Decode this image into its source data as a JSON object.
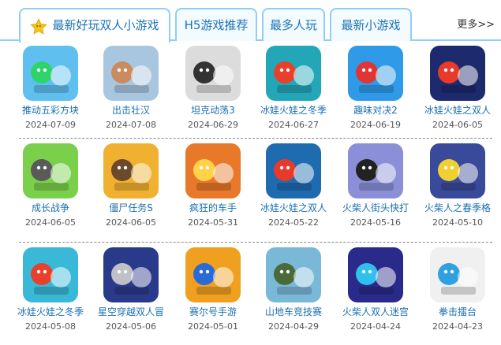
{
  "tabs": [
    {
      "label": "最新好玩双人小游戏",
      "active": true,
      "icon": "star-icon"
    },
    {
      "label": "H5游戏推荐",
      "active": false
    },
    {
      "label": "最多人玩",
      "active": false
    },
    {
      "label": "最新小游戏",
      "active": false
    }
  ],
  "more_label": "更多>>",
  "colors": {
    "accent": "#1a73b5",
    "tab_border": "#8fcff5"
  },
  "games": [
    [
      {
        "name": "推动五彩方块",
        "date": "2024-07-09",
        "bg": "#5fc0f0",
        "fg": "#2ed36a",
        "icon": "colorful-blocks-thumbnail"
      },
      {
        "name": "出击壮汉",
        "date": "2024-07-08",
        "bg": "#a8c6e0",
        "fg": "#c98b5f",
        "icon": "strongman-thumbnail"
      },
      {
        "name": "坦克动荡3",
        "date": "2024-06-29",
        "bg": "#dcdcdc",
        "fg": "#333333",
        "icon": "tank-thumbnail"
      },
      {
        "name": "冰娃火娃之冬季",
        "date": "2024-06-27",
        "bg": "#23a7b8",
        "fg": "#e8402b",
        "icon": "fire-water-winter-thumbnail"
      },
      {
        "name": "趣味对决2",
        "date": "2024-06-19",
        "bg": "#2e9ae8",
        "fg": "#e03535",
        "icon": "fun-duel-thumbnail"
      },
      {
        "name": "冰娃火娃之双人",
        "date": "2024-06-05",
        "bg": "#1e2a6e",
        "fg": "#e83a2a",
        "icon": "fire-water-duo-thumbnail"
      }
    ],
    [
      {
        "name": "成长战争",
        "date": "2024-06-05",
        "bg": "#7ad04a",
        "fg": "#5a5a5a",
        "icon": "growth-war-thumbnail"
      },
      {
        "name": "僵尸任务S",
        "date": "2024-06-05",
        "bg": "#f0b030",
        "fg": "#6a4a2a",
        "icon": "zombie-mission-thumbnail"
      },
      {
        "name": "疯狂的车手",
        "date": "2024-05-31",
        "bg": "#e8782a",
        "fg": "#ffd24a",
        "icon": "crazy-driver-thumbnail"
      },
      {
        "name": "冰娃火娃之双人",
        "date": "2024-05-22",
        "bg": "#1e6bb0",
        "fg": "#e83a2a",
        "icon": "fire-water-pair-thumbnail"
      },
      {
        "name": "火柴人街头快打",
        "date": "2024-05-16",
        "bg": "#8a8fd8",
        "fg": "#222222",
        "icon": "stickman-street-thumbnail"
      },
      {
        "name": "火柴人之春季格",
        "date": "2024-05-10",
        "bg": "#3a4a9a",
        "fg": "#f0d030",
        "icon": "stickman-spring-thumbnail"
      }
    ],
    [
      {
        "name": "冰娃火娃之冬季",
        "date": "2024-05-08",
        "bg": "#3ab8d8",
        "fg": "#e8402b",
        "icon": "fire-water-winter2-thumbnail"
      },
      {
        "name": "星空穿越双人冒",
        "date": "2024-05-06",
        "bg": "#2a3a8a",
        "fg": "#c0c0c8",
        "icon": "space-travel-thumbnail"
      },
      {
        "name": "赛尔号手游",
        "date": "2024-05-01",
        "bg": "#f0a020",
        "fg": "#2a6ad8",
        "icon": "seer-thumbnail"
      },
      {
        "name": "山地车竞技赛",
        "date": "2024-04-29",
        "bg": "#7ab8d8",
        "fg": "#4a6a3a",
        "icon": "mountain-bike-thumbnail"
      },
      {
        "name": "火柴人双人迷宫",
        "date": "2024-04-24",
        "bg": "#2a2a8a",
        "fg": "#30c0f0",
        "icon": "stickman-maze-thumbnail"
      },
      {
        "name": "拳击擂台",
        "date": "2024-04-23",
        "bg": "#f0f0f0",
        "fg": "#30a0e0",
        "icon": "boxing-ring-thumbnail"
      }
    ]
  ]
}
